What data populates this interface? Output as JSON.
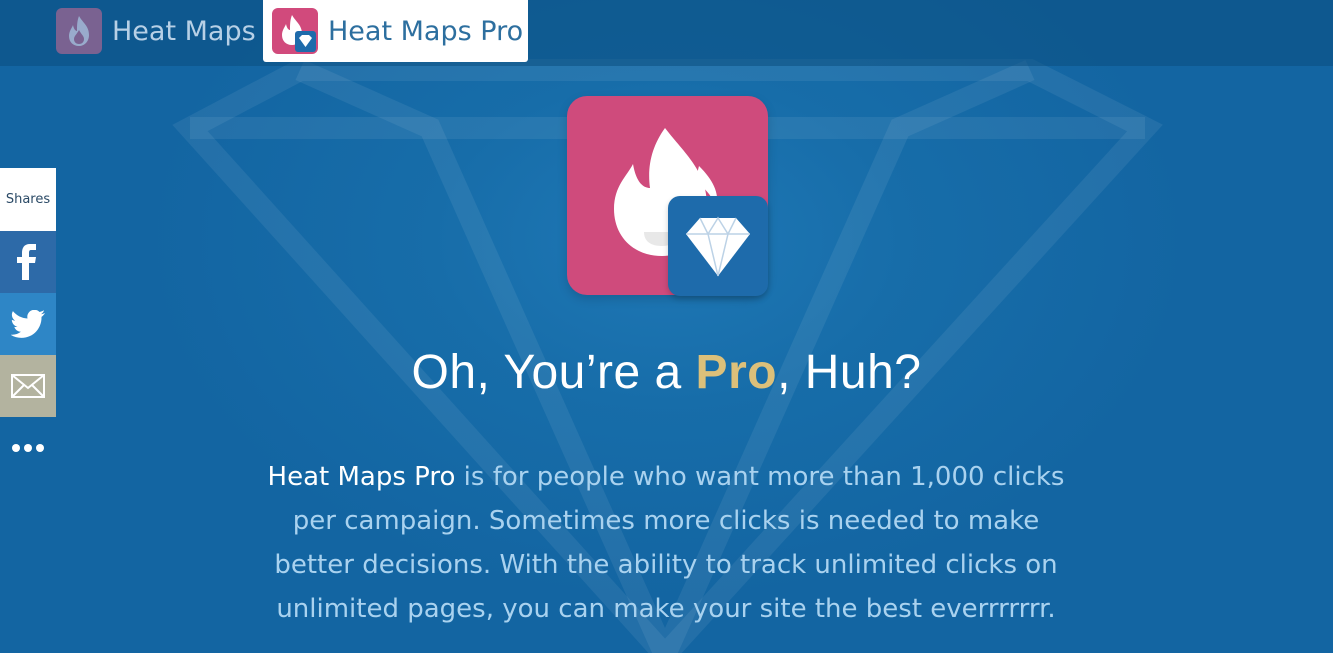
{
  "tabs": [
    {
      "label": "Heat Maps",
      "icon": "flame-icon",
      "active": false
    },
    {
      "label": "Heat Maps Pro",
      "icon": "flame-diamond-icon",
      "active": true
    }
  ],
  "hero": {
    "logo_icon": "flame-diamond-logo",
    "headline_prefix": "Oh, You’re a ",
    "headline_highlight": "Pro",
    "headline_suffix": ", Huh?",
    "description_brand": "Heat Maps Pro",
    "description_rest": " is for people who want more than 1,000 clicks per campaign. Sometimes more clicks is needed to make better decisions. With the ability to track unlimited clicks on unlimited pages, you can make your site the best everrrrrrr."
  },
  "share_bar": {
    "count_label": "Shares",
    "buttons": [
      {
        "name": "facebook",
        "icon": "facebook-icon",
        "color": "#2d6aa8"
      },
      {
        "name": "twitter",
        "icon": "twitter-icon",
        "color": "#2e86c6"
      },
      {
        "name": "email",
        "icon": "mail-icon",
        "color": "#b3b39f"
      },
      {
        "name": "more",
        "icon": "more-dots-icon",
        "color": "#1467a4"
      }
    ]
  },
  "colors": {
    "background": "#1467a4",
    "accent_pink": "#cf4b7c",
    "accent_gold": "#dcc07a",
    "text_light": "#a9d2ef"
  }
}
